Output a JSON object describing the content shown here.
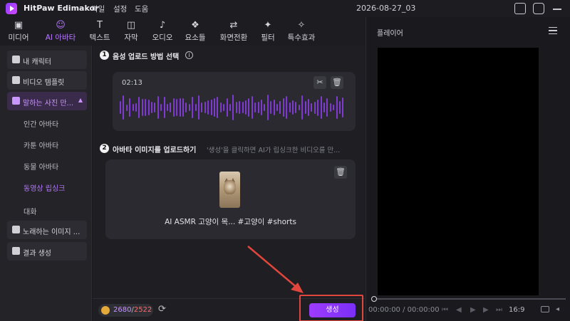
{
  "titlebar": {
    "app_name": "HitPaw Edimakor",
    "menu": [
      "파일",
      "설정",
      "도움"
    ],
    "project_title": "2026-08-27_03"
  },
  "tabs": [
    {
      "label": "미디어",
      "icon": "media-icon"
    },
    {
      "label": "AI 아바타",
      "icon": "avatar-icon",
      "active": true
    },
    {
      "label": "텍스트",
      "icon": "text-icon"
    },
    {
      "label": "자막",
      "icon": "subtitle-icon"
    },
    {
      "label": "오디오",
      "icon": "music-note-icon"
    },
    {
      "label": "요소들",
      "icon": "elements-icon"
    },
    {
      "label": "화면전환",
      "icon": "transition-icon"
    },
    {
      "label": "필터",
      "icon": "sparkle-icon"
    },
    {
      "label": "특수효과",
      "icon": "effects-icon"
    }
  ],
  "sidebar": {
    "items": [
      {
        "label": "내 캐릭터"
      },
      {
        "label": "비디오 템플릿"
      },
      {
        "label": "말하는 사진 만...",
        "active": true
      }
    ],
    "sub_items": [
      {
        "label": "인간 아바타"
      },
      {
        "label": "카툰 아바타"
      },
      {
        "label": "동물 아바타"
      },
      {
        "label": "동영상 립싱크",
        "active": true
      },
      {
        "label": "대화"
      }
    ],
    "bottom_items": [
      {
        "label": "노래하는 이미지 ..."
      },
      {
        "label": "결과 생성"
      }
    ]
  },
  "center": {
    "step1": {
      "num": "1",
      "label": "음성 업로드 방법 선택"
    },
    "audio": {
      "duration": "02:13"
    },
    "step2": {
      "num": "2",
      "label": "아바타 이미지를 업로드하기",
      "hint": "'생성'을 클릭하면 AI가 립싱크한 비디오를 만..."
    },
    "image": {
      "file_name": "AI ASMR 고양이 목... #고양이 #shorts"
    },
    "credits": {
      "used": "2680",
      "separator": "/",
      "total": "2522"
    },
    "generate_label": "생성"
  },
  "player": {
    "title": "플레이어",
    "time": "00:00:00 / 00:00:00",
    "ratio": "16:9"
  },
  "colors": {
    "accent": "#b679ff",
    "button": "#8a33ff",
    "highlight_box": "#e0463c",
    "waveform": "#7e3ad1"
  }
}
